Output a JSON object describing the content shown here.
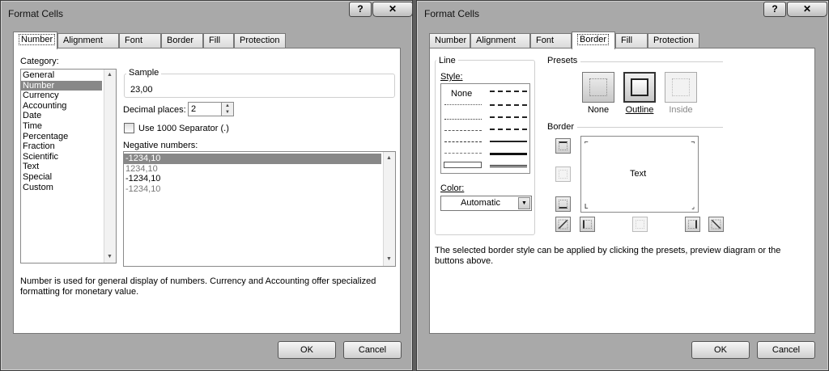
{
  "left_dialog": {
    "title": "Format Cells",
    "help_label": "?",
    "close_label": "✕",
    "tabs": [
      "Number",
      "Alignment",
      "Font",
      "Border",
      "Fill",
      "Protection"
    ],
    "active_tab": "Number",
    "category_label": "Category:",
    "categories": [
      "General",
      "Number",
      "Currency",
      "Accounting",
      "Date",
      "Time",
      "Percentage",
      "Fraction",
      "Scientific",
      "Text",
      "Special",
      "Custom"
    ],
    "selected_category": "Number",
    "sample_label": "Sample",
    "sample_value": "23,00",
    "decimal_places_label": "Decimal places:",
    "decimal_places_value": "2",
    "separator_label": "Use 1000 Separator (.)",
    "negative_numbers_label": "Negative numbers:",
    "negative_numbers": [
      "-1234,10",
      "1234,10",
      "-1234,10",
      "-1234,10"
    ],
    "description": "Number is used for general display of numbers.  Currency and Accounting offer specialized formatting for monetary value.",
    "ok_label": "OK",
    "cancel_label": "Cancel"
  },
  "right_dialog": {
    "title": "Format Cells",
    "help_label": "?",
    "close_label": "✕",
    "tabs": [
      "Number",
      "Alignment",
      "Font",
      "Border",
      "Fill",
      "Protection"
    ],
    "active_tab": "Border",
    "line_label": "Line",
    "style_label": "Style:",
    "style_none_label": "None",
    "color_label": "Color:",
    "color_value": "Automatic",
    "presets_label": "Presets",
    "preset_none_label": "None",
    "preset_outline_label": "Outline",
    "preset_inside_label": "Inside",
    "border_label": "Border",
    "preview_text": "Text",
    "description": "The selected border style can be applied by clicking the presets, preview diagram or the buttons above.",
    "ok_label": "OK",
    "cancel_label": "Cancel"
  }
}
